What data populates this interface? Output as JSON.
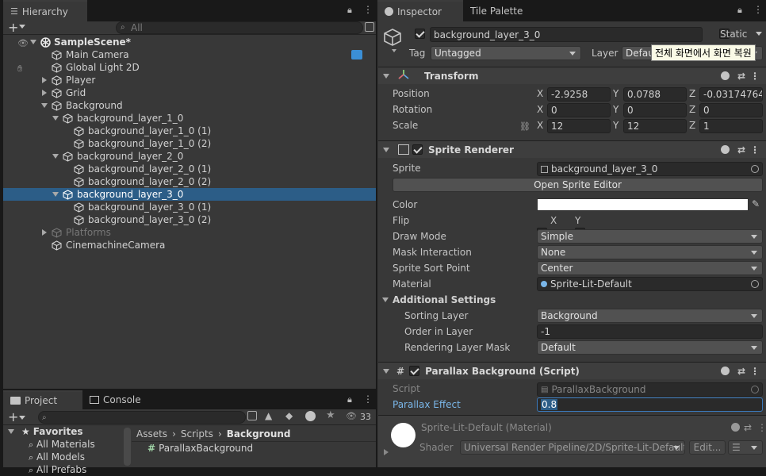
{
  "hierarchy": {
    "tab": "Hierarchy",
    "search_placeholder": "All",
    "scene": "SampleScene*",
    "items": [
      {
        "label": "Main Camera",
        "depth": 1,
        "arrow": ""
      },
      {
        "label": "Global Light 2D",
        "depth": 1,
        "arrow": ""
      },
      {
        "label": "Player",
        "depth": 1,
        "arrow": "r"
      },
      {
        "label": "Grid",
        "depth": 1,
        "arrow": "r"
      },
      {
        "label": "Background",
        "depth": 1,
        "arrow": "d"
      },
      {
        "label": "background_layer_1_0",
        "depth": 2,
        "arrow": "d"
      },
      {
        "label": "background_layer_1_0 (1)",
        "depth": 3,
        "arrow": ""
      },
      {
        "label": "background_layer_1_0 (2)",
        "depth": 3,
        "arrow": ""
      },
      {
        "label": "background_layer_2_0",
        "depth": 2,
        "arrow": "d"
      },
      {
        "label": "background_layer_2_0 (1)",
        "depth": 3,
        "arrow": ""
      },
      {
        "label": "background_layer_2_0 (2)",
        "depth": 3,
        "arrow": ""
      },
      {
        "label": "background_layer_3_0",
        "depth": 2,
        "arrow": "d",
        "selected": true
      },
      {
        "label": "background_layer_3_0 (1)",
        "depth": 3,
        "arrow": ""
      },
      {
        "label": "background_layer_3_0 (2)",
        "depth": 3,
        "arrow": ""
      },
      {
        "label": "Platforms",
        "depth": 1,
        "arrow": "r",
        "dim": true
      },
      {
        "label": "CinemachineCamera",
        "depth": 1,
        "arrow": ""
      }
    ]
  },
  "project": {
    "tab_project": "Project",
    "tab_console": "Console",
    "count": "33",
    "favorites": "Favorites",
    "fav_items": [
      "All Materials",
      "All Models",
      "All Prefabs"
    ],
    "breadcrumb": [
      "Assets",
      "Scripts",
      "Background"
    ],
    "file": "ParallaxBackground"
  },
  "inspector": {
    "tab": "Inspector",
    "tab2": "Tile Palette",
    "name": "background_layer_3_0",
    "static": "Static",
    "tag_label": "Tag",
    "tag": "Untagged",
    "layer_label": "Layer",
    "layer": "Defau",
    "tooltip": "전체 화면에서 화면 복원",
    "transform": {
      "title": "Transform",
      "pos_label": "Position",
      "rot_label": "Rotation",
      "scale_label": "Scale",
      "pos": [
        "-2.9258",
        "0.0788",
        "-0.03174764"
      ],
      "rot": [
        "0",
        "0",
        "0"
      ],
      "scale": [
        "12",
        "12",
        "1"
      ],
      "axes": [
        "X",
        "Y",
        "Z"
      ]
    },
    "sprite_renderer": {
      "title": "Sprite Renderer",
      "sprite_label": "Sprite",
      "sprite": "background_layer_3_0",
      "open_editor": "Open Sprite Editor",
      "color_label": "Color",
      "color": "#ffffff",
      "flip_label": "Flip",
      "flip_x": "X",
      "flip_y": "Y",
      "draw_mode_label": "Draw Mode",
      "draw_mode": "Simple",
      "mask_label": "Mask Interaction",
      "mask": "None",
      "sort_point_label": "Sprite Sort Point",
      "sort_point": "Center",
      "material_label": "Material",
      "material": "Sprite-Lit-Default",
      "additional": "Additional Settings",
      "sorting_layer_label": "Sorting Layer",
      "sorting_layer": "Background",
      "order_label": "Order in Layer",
      "order": "-1",
      "rlm_label": "Rendering Layer Mask",
      "rlm": "Default"
    },
    "parallax": {
      "title": "Parallax Background (Script)",
      "script_label": "Script",
      "script": "ParallaxBackground",
      "effect_label": "Parallax Effect",
      "effect": "0.8"
    },
    "material": {
      "name": "Sprite-Lit-Default (Material)",
      "shader_label": "Shader",
      "shader": "Universal Render Pipeline/2D/Sprite-Lit-Default",
      "edit": "Edit..."
    }
  }
}
